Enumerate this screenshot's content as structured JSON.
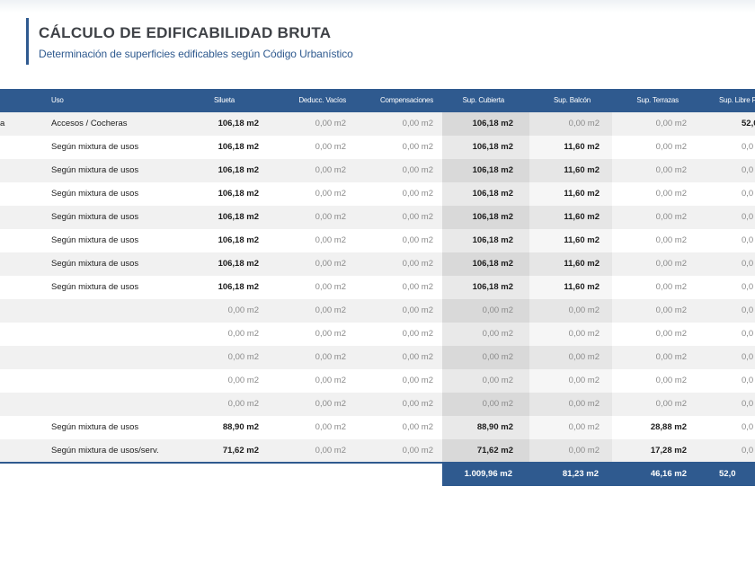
{
  "header": {
    "title": "CÁLCULO DE EDIFICABILIDAD BRUTA",
    "subtitle": "Determinación de superficies edificables según Código Urbanístico"
  },
  "table": {
    "columns": [
      "Uso",
      "Silueta",
      "Deducc. Vacíos",
      "Compensaciones",
      "Sup. Cubierta",
      "Sup. Balcón",
      "Sup. Terrazas",
      "Sup. Libre Fo"
    ],
    "rows": [
      {
        "lead": "a",
        "uso": "Accesos / Cocheras",
        "silueta": "106,18 m2",
        "vacios": "0,00 m2",
        "comp": "0,00 m2",
        "cubierta": "106,18 m2",
        "balcon": "0,00 m2",
        "terrazas": "0,00 m2",
        "libre": "52,0"
      },
      {
        "lead": "",
        "uso": "Según mixtura de usos",
        "silueta": "106,18 m2",
        "vacios": "0,00 m2",
        "comp": "0,00 m2",
        "cubierta": "106,18 m2",
        "balcon": "11,60 m2",
        "terrazas": "0,00 m2",
        "libre": "0,0"
      },
      {
        "lead": "",
        "uso": "Según mixtura de usos",
        "silueta": "106,18 m2",
        "vacios": "0,00 m2",
        "comp": "0,00 m2",
        "cubierta": "106,18 m2",
        "balcon": "11,60 m2",
        "terrazas": "0,00 m2",
        "libre": "0,0"
      },
      {
        "lead": "",
        "uso": "Según mixtura de usos",
        "silueta": "106,18 m2",
        "vacios": "0,00 m2",
        "comp": "0,00 m2",
        "cubierta": "106,18 m2",
        "balcon": "11,60 m2",
        "terrazas": "0,00 m2",
        "libre": "0,0"
      },
      {
        "lead": "",
        "uso": "Según mixtura de usos",
        "silueta": "106,18 m2",
        "vacios": "0,00 m2",
        "comp": "0,00 m2",
        "cubierta": "106,18 m2",
        "balcon": "11,60 m2",
        "terrazas": "0,00 m2",
        "libre": "0,0"
      },
      {
        "lead": "",
        "uso": "Según mixtura de usos",
        "silueta": "106,18 m2",
        "vacios": "0,00 m2",
        "comp": "0,00 m2",
        "cubierta": "106,18 m2",
        "balcon": "11,60 m2",
        "terrazas": "0,00 m2",
        "libre": "0,0"
      },
      {
        "lead": "",
        "uso": "Según mixtura de usos",
        "silueta": "106,18 m2",
        "vacios": "0,00 m2",
        "comp": "0,00 m2",
        "cubierta": "106,18 m2",
        "balcon": "11,60 m2",
        "terrazas": "0,00 m2",
        "libre": "0,0"
      },
      {
        "lead": "",
        "uso": "Según mixtura de usos",
        "silueta": "106,18 m2",
        "vacios": "0,00 m2",
        "comp": "0,00 m2",
        "cubierta": "106,18 m2",
        "balcon": "11,60 m2",
        "terrazas": "0,00 m2",
        "libre": "0,0"
      },
      {
        "lead": "",
        "uso": "",
        "silueta": "0,00 m2",
        "vacios": "0,00 m2",
        "comp": "0,00 m2",
        "cubierta": "0,00 m2",
        "balcon": "0,00 m2",
        "terrazas": "0,00 m2",
        "libre": "0,0"
      },
      {
        "lead": "",
        "uso": "",
        "silueta": "0,00 m2",
        "vacios": "0,00 m2",
        "comp": "0,00 m2",
        "cubierta": "0,00 m2",
        "balcon": "0,00 m2",
        "terrazas": "0,00 m2",
        "libre": "0,0"
      },
      {
        "lead": "",
        "uso": "",
        "silueta": "0,00 m2",
        "vacios": "0,00 m2",
        "comp": "0,00 m2",
        "cubierta": "0,00 m2",
        "balcon": "0,00 m2",
        "terrazas": "0,00 m2",
        "libre": "0,0"
      },
      {
        "lead": "",
        "uso": "",
        "silueta": "0,00 m2",
        "vacios": "0,00 m2",
        "comp": "0,00 m2",
        "cubierta": "0,00 m2",
        "balcon": "0,00 m2",
        "terrazas": "0,00 m2",
        "libre": "0,0"
      },
      {
        "lead": "",
        "uso": "",
        "silueta": "0,00 m2",
        "vacios": "0,00 m2",
        "comp": "0,00 m2",
        "cubierta": "0,00 m2",
        "balcon": "0,00 m2",
        "terrazas": "0,00 m2",
        "libre": "0,0"
      },
      {
        "lead": "",
        "uso": "Según mixtura de usos",
        "silueta": "88,90 m2",
        "vacios": "0,00 m2",
        "comp": "0,00 m2",
        "cubierta": "88,90 m2",
        "balcon": "0,00 m2",
        "terrazas": "28,88 m2",
        "libre": "0,0"
      },
      {
        "lead": "",
        "uso": "Según mixtura de usos/serv.",
        "silueta": "71,62 m2",
        "vacios": "0,00 m2",
        "comp": "0,00 m2",
        "cubierta": "71,62 m2",
        "balcon": "0,00 m2",
        "terrazas": "17,28 m2",
        "libre": "0,0"
      }
    ],
    "totals": {
      "cubierta": "1.009,96 m2",
      "balcon": "81,23 m2",
      "terrazas": "46,16 m2",
      "libre": "52,0"
    }
  },
  "colors": {
    "accent": "#2f5a8f",
    "row_alt": "#f1f1f1",
    "shaded_col": "#d9d9d9"
  }
}
